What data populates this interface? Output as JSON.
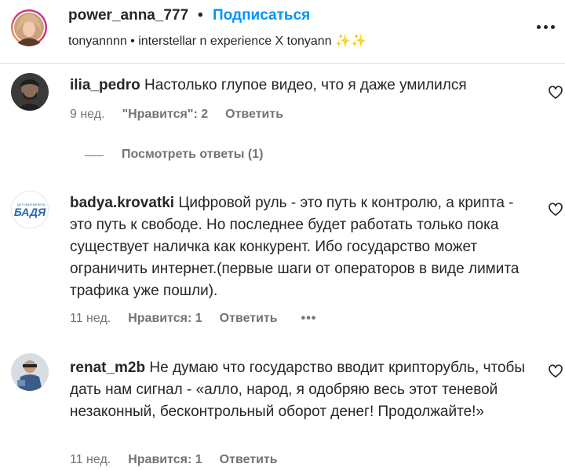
{
  "header": {
    "username": "power_anna_777",
    "separator": "•",
    "follow_label": "Подписаться",
    "audio_line": "tonyannnn • interstellar n experience X tonyann ✨✨"
  },
  "comments": [
    {
      "username": "ilia_pedro",
      "text": "Настолько глупое видео, что я даже умилился",
      "time": "9 нед.",
      "likes": "\"Нравится\": 2",
      "reply": "Ответить",
      "view_replies": "Посмотреть ответы (1)"
    },
    {
      "username": "badya.krovatki",
      "avatar_brand": "БАДЯ",
      "avatar_tagline": "ДЕТСКАЯ МЕБЕЛЬ",
      "text": "Цифровой руль - это путь к контролю, а крипта - это путь к свободе. Но последнее будет работать только пока существует наличка как конкурент. Ибо государство может ограничить интернет.(первые шаги от операторов в виде лимита трафика уже пошли).",
      "time": "11 нед.",
      "likes": "Нравится: 1",
      "reply": "Ответить",
      "more": "•••"
    },
    {
      "username": "renat_m2b",
      "text": "Не думаю что государство вводит крипторубль, чтобы дать нам сигнал - «алло, народ, я одобряю весь этот теневой незаконный, бесконтрольный оборот денег! Продолжайте!»",
      "time": "11 нед.",
      "likes": "Нравится: 1",
      "reply": "Ответить"
    }
  ],
  "colors": {
    "text": "#262626",
    "secondary": "#737373",
    "link": "#0095f6",
    "divider": "#dbdbdb",
    "brand_blue": "#2a66b3"
  },
  "icons": [
    "more-options-icon",
    "heart-icon"
  ]
}
